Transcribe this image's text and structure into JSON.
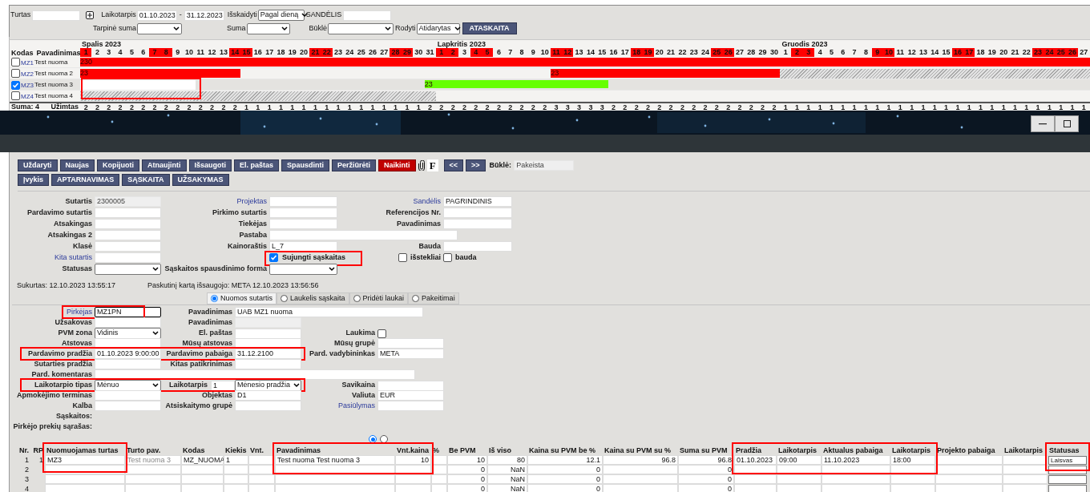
{
  "filter_bar": {
    "asset_label": "Turtas",
    "period_label": "Laikotarpis",
    "period_from": "01.10.2023",
    "period_sep": "-",
    "period_to": "31.12.2023",
    "split_label": "Išskaidyti",
    "split_value": "Pagal dieną",
    "warehouse_label": "SANDĖLIS",
    "subtotal_label": "Tarpinė suma",
    "sum_label": "Suma",
    "state_label": "Būklė",
    "show_label": "Rodyti",
    "show_value": "Atidarytas",
    "report_button": "ATASKAITA"
  },
  "gantt": {
    "code_header": "Kodas",
    "name_header": "Pavadinimas",
    "total_label": "Suma: 4",
    "occupied_label": "Užimtas",
    "months": [
      {
        "name": "Spalis 2023",
        "days": [
          {
            "n": "1",
            "red": true,
            "count": "2"
          },
          {
            "n": "2",
            "red": false,
            "count": "2"
          },
          {
            "n": "3",
            "red": false,
            "count": "2"
          },
          {
            "n": "4",
            "red": false,
            "count": "2"
          },
          {
            "n": "5",
            "red": false,
            "count": "2"
          },
          {
            "n": "6",
            "red": false,
            "count": "2"
          },
          {
            "n": "7",
            "red": true,
            "count": "2"
          },
          {
            "n": "8",
            "red": true,
            "count": "2"
          },
          {
            "n": "9",
            "red": false,
            "count": "2"
          },
          {
            "n": "10",
            "red": false,
            "count": "2"
          },
          {
            "n": "11",
            "red": false,
            "count": "2"
          },
          {
            "n": "12",
            "red": false,
            "count": "2"
          },
          {
            "n": "13",
            "red": false,
            "count": "2"
          },
          {
            "n": "14",
            "red": true,
            "count": "2"
          },
          {
            "n": "15",
            "red": true,
            "count": "1"
          },
          {
            "n": "16",
            "red": false,
            "count": "1"
          },
          {
            "n": "17",
            "red": false,
            "count": "1"
          },
          {
            "n": "18",
            "red": false,
            "count": "1"
          },
          {
            "n": "19",
            "red": false,
            "count": "1"
          },
          {
            "n": "20",
            "red": false,
            "count": "1"
          },
          {
            "n": "21",
            "red": true,
            "count": "1"
          },
          {
            "n": "22",
            "red": true,
            "count": "1"
          },
          {
            "n": "23",
            "red": false,
            "count": "1"
          },
          {
            "n": "24",
            "red": false,
            "count": "1"
          },
          {
            "n": "25",
            "red": false,
            "count": "1"
          },
          {
            "n": "26",
            "red": false,
            "count": "1"
          },
          {
            "n": "27",
            "red": false,
            "count": "1"
          },
          {
            "n": "28",
            "red": true,
            "count": "1"
          },
          {
            "n": "29",
            "red": true,
            "count": "1"
          },
          {
            "n": "30",
            "red": false,
            "count": "1"
          },
          {
            "n": "31",
            "red": false,
            "count": "2"
          }
        ]
      },
      {
        "name": "Lapkritis 2023",
        "days": [
          {
            "n": "1",
            "red": true,
            "count": "2"
          },
          {
            "n": "2",
            "red": true,
            "count": "2"
          },
          {
            "n": "3",
            "red": false,
            "count": "2"
          },
          {
            "n": "4",
            "red": true,
            "count": "2"
          },
          {
            "n": "5",
            "red": true,
            "count": "2"
          },
          {
            "n": "6",
            "red": false,
            "count": "2"
          },
          {
            "n": "7",
            "red": false,
            "count": "2"
          },
          {
            "n": "8",
            "red": false,
            "count": "2"
          },
          {
            "n": "9",
            "red": false,
            "count": "2"
          },
          {
            "n": "10",
            "red": false,
            "count": "2"
          },
          {
            "n": "11",
            "red": true,
            "count": "3"
          },
          {
            "n": "12",
            "red": true,
            "count": "3"
          },
          {
            "n": "13",
            "red": false,
            "count": "3"
          },
          {
            "n": "14",
            "red": false,
            "count": "3"
          },
          {
            "n": "15",
            "red": false,
            "count": "3"
          },
          {
            "n": "16",
            "red": false,
            "count": "2"
          },
          {
            "n": "17",
            "red": false,
            "count": "2"
          },
          {
            "n": "18",
            "red": true,
            "count": "2"
          },
          {
            "n": "19",
            "red": true,
            "count": "2"
          },
          {
            "n": "20",
            "red": false,
            "count": "2"
          },
          {
            "n": "21",
            "red": false,
            "count": "2"
          },
          {
            "n": "22",
            "red": false,
            "count": "2"
          },
          {
            "n": "23",
            "red": false,
            "count": "2"
          },
          {
            "n": "24",
            "red": false,
            "count": "2"
          },
          {
            "n": "25",
            "red": true,
            "count": "2"
          },
          {
            "n": "26",
            "red": true,
            "count": "2"
          },
          {
            "n": "27",
            "red": false,
            "count": "2"
          },
          {
            "n": "28",
            "red": false,
            "count": "2"
          },
          {
            "n": "29",
            "red": false,
            "count": "2"
          },
          {
            "n": "30",
            "red": false,
            "count": "2"
          }
        ]
      },
      {
        "name": "Gruodis 2023",
        "days": [
          {
            "n": "1",
            "red": false,
            "count": "1"
          },
          {
            "n": "2",
            "red": true,
            "count": "1"
          },
          {
            "n": "3",
            "red": true,
            "count": "1"
          },
          {
            "n": "4",
            "red": false,
            "count": "1"
          },
          {
            "n": "5",
            "red": false,
            "count": "1"
          },
          {
            "n": "6",
            "red": false,
            "count": "1"
          },
          {
            "n": "7",
            "red": false,
            "count": "1"
          },
          {
            "n": "8",
            "red": false,
            "count": "1"
          },
          {
            "n": "9",
            "red": true,
            "count": "1"
          },
          {
            "n": "10",
            "red": true,
            "count": "1"
          },
          {
            "n": "11",
            "red": false,
            "count": "1"
          },
          {
            "n": "12",
            "red": false,
            "count": "1"
          },
          {
            "n": "13",
            "red": false,
            "count": "1"
          },
          {
            "n": "14",
            "red": false,
            "count": "1"
          },
          {
            "n": "15",
            "red": false,
            "count": "1"
          },
          {
            "n": "16",
            "red": true,
            "count": "1"
          },
          {
            "n": "17",
            "red": true,
            "count": "1"
          },
          {
            "n": "18",
            "red": false,
            "count": "1"
          },
          {
            "n": "19",
            "red": false,
            "count": "1"
          },
          {
            "n": "20",
            "red": false,
            "count": "1"
          },
          {
            "n": "21",
            "red": false,
            "count": "1"
          },
          {
            "n": "22",
            "red": false,
            "count": "1"
          },
          {
            "n": "23",
            "red": true,
            "count": "1"
          },
          {
            "n": "24",
            "red": true,
            "count": "1"
          },
          {
            "n": "25",
            "red": true,
            "count": "1"
          },
          {
            "n": "26",
            "red": true,
            "count": "1"
          },
          {
            "n": "27",
            "red": false,
            "count": "1"
          }
        ]
      }
    ],
    "rows": [
      {
        "code": "MZ1",
        "name": "Test nuoma",
        "checked": false,
        "segments": [
          {
            "kind": "booked",
            "label": "230",
            "level": 1
          }
        ]
      },
      {
        "code": "MZ2",
        "name": "Test nuoma 2",
        "checked": false,
        "segments": [
          {
            "kind": "booked",
            "label": "23",
            "level": 0.159
          },
          {
            "kind": "gap",
            "level": 0.307
          },
          {
            "kind": "booked",
            "label": "23",
            "level": 0.227
          },
          {
            "kind": "unavailable",
            "level": 0.307
          }
        ]
      },
      {
        "code": "MZ3",
        "name": "Test nuoma 3",
        "checked": true,
        "segments": [
          {
            "kind": "blank",
            "level": 0.114
          },
          {
            "kind": "gap",
            "level": 0.227
          },
          {
            "kind": "active",
            "label": "23",
            "level": 0.182
          }
        ]
      },
      {
        "code": "MZ4",
        "name": "Test nuoma 4",
        "checked": false,
        "segments": [
          {
            "kind": "unavailable",
            "level": 0.352
          }
        ]
      }
    ]
  },
  "toolbar": {
    "buttons": [
      {
        "label": "Uždaryti",
        "kind": "normal"
      },
      {
        "label": "Naujas",
        "kind": "normal"
      },
      {
        "label": "Kopijuoti",
        "kind": "normal"
      },
      {
        "label": "Atnaujinti",
        "kind": "normal"
      },
      {
        "label": "Išsaugoti",
        "kind": "normal"
      },
      {
        "label": "El. paštas",
        "kind": "normal"
      },
      {
        "label": "Spausdinti",
        "kind": "normal"
      },
      {
        "label": "Peržiūrėti",
        "kind": "normal"
      },
      {
        "label": "Naikinti",
        "kind": "danger"
      }
    ],
    "format_label": "F",
    "prev": "<<",
    "next": ">>",
    "state_label": "Būklė:",
    "state_value": "Pakeista",
    "actions": [
      "Įvykis",
      "APTARNAVIMAS",
      "SĄSKAITA",
      "UŽSAKYMAS"
    ]
  },
  "contract_form": {
    "rows": [
      [
        {
          "kind": "input",
          "label": "Sutartis",
          "value": "2300005",
          "disabled": true
        },
        {
          "kind": "input",
          "label": "Projektas",
          "link": true
        },
        {
          "kind": "input",
          "label": "Sandėlis",
          "link": true,
          "value": "PAGRINDINIS"
        }
      ],
      [
        {
          "kind": "input",
          "label": "Pardavimo sutartis"
        },
        {
          "kind": "input",
          "label": "Pirkimo sutartis"
        },
        {
          "kind": "input",
          "label": "Referencijos Nr."
        }
      ],
      [
        {
          "kind": "input",
          "label": "Atsakingas"
        },
        {
          "kind": "input",
          "label": "Tiekėjas"
        },
        {
          "kind": "input",
          "label": "Pavadinimas"
        }
      ],
      [
        {
          "kind": "input",
          "label": "Atsakingas 2"
        },
        {
          "kind": "wide_input",
          "label": "Pastaba"
        }
      ],
      [
        {
          "kind": "input",
          "label": "Klasė"
        },
        {
          "kind": "input",
          "label": "Kainoraštis",
          "value": "L_7"
        },
        {
          "kind": "input",
          "label": "Bauda"
        }
      ],
      [
        {
          "kind": "input",
          "label": "Kita sutartis",
          "link": true
        },
        {
          "kind": "checkbox",
          "label": "Sujungti sąskaitas",
          "checked": true
        },
        {
          "kind": "checkboxes",
          "options": [
            {
              "label": "išstekliai",
              "checked": false
            },
            {
              "label": "bauda",
              "checked": false
            }
          ]
        }
      ],
      [
        {
          "kind": "select",
          "label": "Statusas"
        },
        {
          "kind": "select",
          "label": "Sąskaitos spausdinimo forma"
        },
        {
          "kind": "none"
        }
      ]
    ],
    "created": "Sukurtas: 12.10.2023 13:55:17",
    "saved": "Paskutinį kartą išsaugojo: META 12.10.2023 13:56:56"
  },
  "tabs": [
    {
      "label": "Nuomos sutartis",
      "selected": true
    },
    {
      "label": "Laukelis sąskaita",
      "selected": false
    },
    {
      "label": "Pridėti laukai",
      "selected": false
    },
    {
      "label": "Pakeitimai",
      "selected": false
    }
  ],
  "rental_form": {
    "rows": [
      [
        {
          "kind": "input",
          "label": "Pirkėjas",
          "link": true,
          "value": "MZ1PN",
          "focused": true
        },
        {
          "kind": "wide_input",
          "label": "Pavadinimas",
          "value": "UAB MZ1 nuoma"
        }
      ],
      [
        {
          "kind": "input",
          "label": "Užsakovas"
        },
        {
          "kind": "input",
          "label": "Pavadinimas",
          "disabled": true
        },
        {
          "kind": "none"
        }
      ],
      [
        {
          "kind": "select",
          "label": "PVM zona",
          "value": "Vidinis"
        },
        {
          "kind": "input",
          "label": "El. paštas"
        },
        {
          "kind": "check_field",
          "label": "Laukima",
          "checked": false
        }
      ],
      [
        {
          "kind": "input",
          "label": "Atstovas"
        },
        {
          "kind": "input",
          "label": "Mūsų atstovas"
        },
        {
          "kind": "input",
          "label": "Mūsų grupė"
        }
      ],
      [
        {
          "kind": "input",
          "label": "Pardavimo pradžia",
          "value": "01.10.2023 9:00:00"
        },
        {
          "kind": "input",
          "label": "Pardavimo pabaiga",
          "value": "31.12.2100"
        },
        {
          "kind": "input",
          "label": "Pard. vadybininkas",
          "value": "META"
        }
      ],
      [
        {
          "kind": "input",
          "label": "Sutarties pradžia"
        },
        {
          "kind": "input",
          "label": "Kitas patikrinimas"
        },
        {
          "kind": "none"
        }
      ],
      [
        {
          "kind": "long_input",
          "label": "Pard. komentaras"
        }
      ],
      [
        {
          "kind": "select",
          "label": "Laikotarpio tipas",
          "value": "Mėnuo"
        },
        {
          "kind": "input_select",
          "label": "Laikotarpis",
          "value": "1",
          "option": "Mėnesio pradžia"
        },
        {
          "kind": "input",
          "label": "Savikaina"
        }
      ],
      [
        {
          "kind": "input",
          "label": "Apmokėjimo terminas"
        },
        {
          "kind": "input",
          "label": "Objektas",
          "value": "D1"
        },
        {
          "kind": "input",
          "label": "Valiuta",
          "value": "EUR"
        }
      ],
      [
        {
          "kind": "input",
          "label": "Kalba"
        },
        {
          "kind": "input",
          "label": "Atsiskaitymo grupė"
        },
        {
          "kind": "input",
          "label": "Pasiūlymas",
          "link": true
        }
      ],
      [
        {
          "kind": "label_only",
          "label": "Sąskaitos:"
        }
      ],
      [
        {
          "kind": "label_only",
          "label": "Pirkėjo prekių sąrašas:"
        }
      ]
    ],
    "radios": [
      {
        "selected": true
      },
      {
        "selected": false
      }
    ]
  },
  "table": {
    "columns": [
      "Nr.",
      "RP",
      "Nuomuojamas turtas",
      "Turto pav.",
      "Kodas",
      "Kiekis",
      "Vnt.",
      "Pavadinimas",
      "Vnt.kaina",
      "%",
      "Be PVM",
      "Iš viso",
      "Kaina su PVM be %",
      "Kaina su PVM su %",
      "Suma su PVM",
      "Pradžia",
      "Laikotarpis",
      "Aktualus pabaiga",
      "Laikotarpis",
      "Projekto pabaiga",
      "Laikotarpis",
      "Statusas"
    ],
    "rows": [
      {
        "nr": "1",
        "rp": "1",
        "asset": "MZ3",
        "asset_name": "Test nuoma 3",
        "code": "MZ_NUOMA",
        "qty": "1",
        "name": "Test nuoma Test nuoma 3",
        "unit_price": "10",
        "no_vat": "10",
        "total": "80",
        "price_vat_no_disc": "12.1",
        "price_vat_disc": "96.8",
        "sum_vat": "96.8",
        "start": "01.10.2023",
        "start_time": "09:00",
        "actual_end": "11.10.2023",
        "end_time": "18:00",
        "status": "Laisvas"
      },
      {
        "nr": "2",
        "no_vat": "0",
        "total": "NaN",
        "price_vat_no_disc": "0",
        "sum_vat": "0"
      },
      {
        "nr": "3",
        "no_vat": "0",
        "total": "NaN",
        "price_vat_no_disc": "0",
        "sum_vat": "0"
      },
      {
        "nr": "4",
        "no_vat": "0",
        "total": "NaN",
        "price_vat_no_disc": "0",
        "sum_vat": "0"
      }
    ]
  }
}
